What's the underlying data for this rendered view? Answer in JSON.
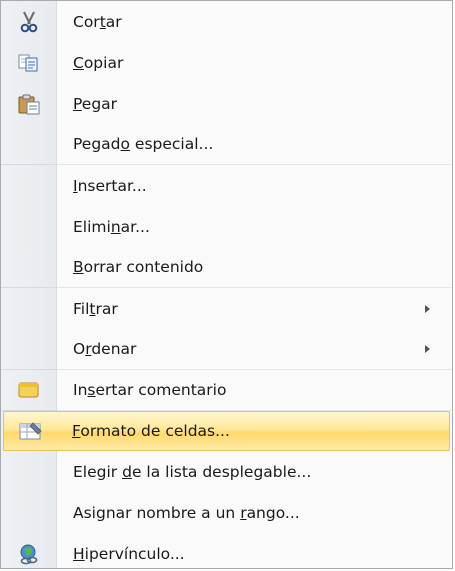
{
  "menu": {
    "items": [
      {
        "name": "cortar",
        "pre": "Cor",
        "u": "t",
        "post": "ar",
        "icon": "scissors-icon"
      },
      {
        "name": "copiar",
        "pre": "",
        "u": "C",
        "post": "opiar",
        "icon": "copy-icon"
      },
      {
        "name": "pegar",
        "pre": "",
        "u": "P",
        "post": "egar",
        "icon": "paste-icon"
      },
      {
        "name": "pegado-especial",
        "pre": "Pegad",
        "u": "o",
        "post": " especial...",
        "icon": ""
      },
      {
        "name": "insertar",
        "pre": "",
        "u": "I",
        "post": "nsertar...",
        "icon": ""
      },
      {
        "name": "eliminar",
        "pre": "Elimi",
        "u": "n",
        "post": "ar...",
        "icon": ""
      },
      {
        "name": "borrar-contenido",
        "pre": "",
        "u": "B",
        "post": "orrar contenido",
        "icon": ""
      },
      {
        "name": "filtrar",
        "pre": "Fil",
        "u": "t",
        "post": "rar",
        "icon": "",
        "submenu": true
      },
      {
        "name": "ordenar",
        "pre": "O",
        "u": "r",
        "post": "denar",
        "icon": "",
        "submenu": true
      },
      {
        "name": "insertar-comentario",
        "pre": "In",
        "u": "s",
        "post": "ertar comentario",
        "icon": "comment-icon"
      },
      {
        "name": "formato-de-celdas",
        "pre": "",
        "u": "F",
        "post": "ormato de celdas...",
        "icon": "format-cells-icon",
        "highlighted": true
      },
      {
        "name": "elegir-de-la-lista",
        "pre": "Elegir ",
        "u": "d",
        "post": "e la lista desplegable...",
        "icon": ""
      },
      {
        "name": "asignar-nombre",
        "pre": "Asignar nombre a un ",
        "u": "r",
        "post": "ango...",
        "icon": ""
      },
      {
        "name": "hipervinculo",
        "pre": "",
        "u": "H",
        "post": "ipervínculo...",
        "icon": "hyperlink-icon"
      }
    ]
  },
  "colors": {
    "highlight_top": "#fff6cf",
    "highlight_bottom": "#ffd86b",
    "gutter": "#eceff3",
    "text": "#1a1a1a"
  }
}
